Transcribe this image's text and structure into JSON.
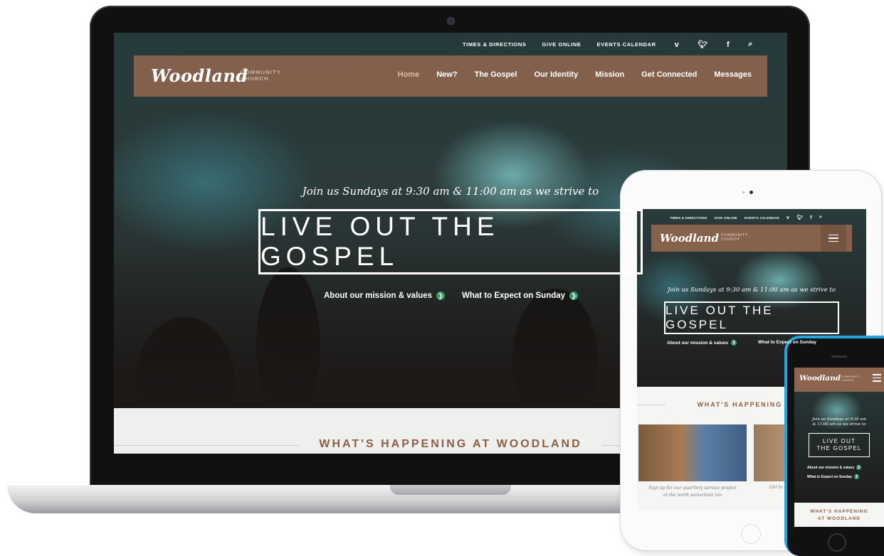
{
  "site": {
    "logo": "Woodland",
    "logo_sub_line1": "COMMUNITY",
    "logo_sub_line2": "CHURCH",
    "brand_color": "#96694f",
    "accent_color": "#3c9a6a"
  },
  "utility_nav": {
    "times": "TIMES & DIRECTIONS",
    "give": "GIVE ONLINE",
    "events": "EVENTS CALENDAR",
    "icons": [
      "vimeo-icon",
      "twitter-icon",
      "facebook-icon",
      "search-icon"
    ]
  },
  "main_nav": [
    "Home",
    "New?",
    "The Gospel",
    "Our Identity",
    "Mission",
    "Get Connected",
    "Messages"
  ],
  "hero": {
    "tagline": "Join us Sundays at 9:30 am & 11:00 am as we strive to",
    "headline": "LIVE OUT THE GOSPEL",
    "cta_mission": "About our mission & values",
    "cta_sunday": "What to Expect on Sunday"
  },
  "section": {
    "happening_title": "WHAT'S HAPPENING AT WOODLAND",
    "happening_title_tablet": "WHAT'S HAPPENING AT W"
  },
  "tablet": {
    "caption1_line1": "Sign up for our quartlery service project",
    "caption1_line2": "at the north samaritain inn",
    "caption2_partial": "Get to"
  },
  "phone": {
    "tagline_line1": "Join us Sundays at 9:30 am",
    "tagline_line2": "& 11:00 am as we strive to",
    "headline_line1": "LIVE OUT",
    "headline_line2": "THE GOSPEL",
    "happening_line1": "WHAT'S HAPPENING",
    "happening_line2": "AT WOODLAND"
  }
}
